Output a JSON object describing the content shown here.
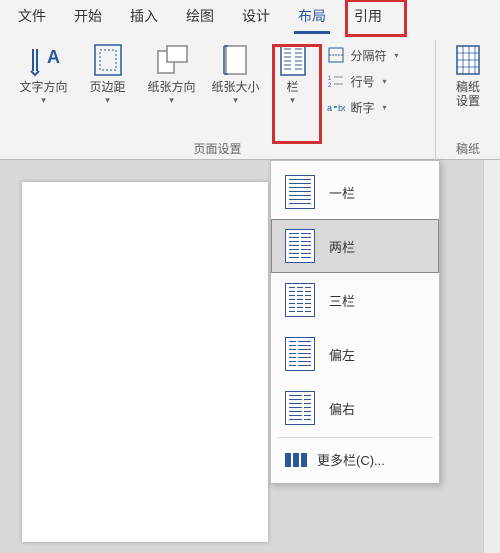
{
  "tabs": {
    "file": "文件",
    "home": "开始",
    "insert": "插入",
    "draw": "绘图",
    "design": "设计",
    "layout": "布局",
    "references": "引用"
  },
  "ribbon": {
    "text_direction": "文字方向",
    "margins": "页边距",
    "orientation": "纸张方向",
    "size": "纸张大小",
    "columns": "栏",
    "breaks": "分隔符",
    "line_numbers": "行号",
    "hyphenation": "断字",
    "manuscript_settings_l1": "稿纸",
    "manuscript_settings_l2": "设置",
    "group_page_setup": "页面设置",
    "group_manuscript": "稿纸"
  },
  "columns_menu": {
    "one": "一栏",
    "two": "两栏",
    "three": "三栏",
    "left": "偏左",
    "right": "偏右",
    "more": "更多栏(C)..."
  }
}
